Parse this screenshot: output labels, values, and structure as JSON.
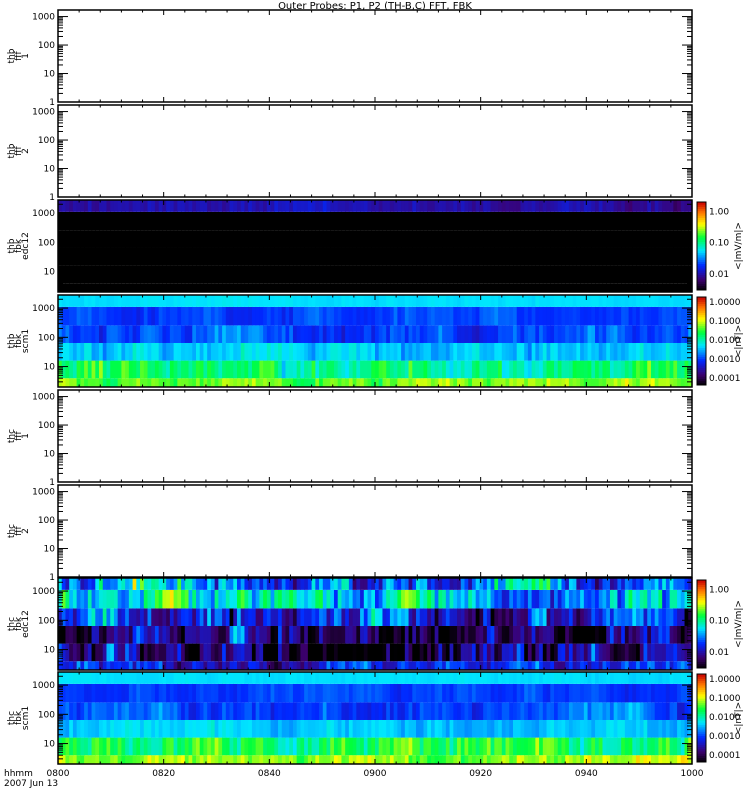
{
  "chart_data": {
    "type": "heatmap",
    "title": "Outer Probes: P1, P2 (TH-B,C) FFT, FBK",
    "x_ticks": [
      "0800",
      "0820",
      "0840",
      "0900",
      "0920",
      "0940",
      "1000"
    ],
    "x_range_minutes": [
      0,
      120
    ],
    "xlabel": "hhmm",
    "date_label": "2007 Jun 13",
    "panels": [
      {
        "label": [
          "thb",
          "fff",
          "1"
        ],
        "kind": "empty",
        "ylim": [
          1,
          1700
        ],
        "yticks": [
          "1",
          "10",
          "100",
          "1000"
        ]
      },
      {
        "label": [
          "thb",
          "fff",
          "2"
        ],
        "kind": "empty",
        "ylim": [
          1,
          1700
        ],
        "yticks": [
          "1",
          "10",
          "100",
          "1000"
        ]
      },
      {
        "label": [
          "thb",
          "fbk",
          "edc12"
        ],
        "kind": "spec",
        "ylim": [
          2,
          2800
        ],
        "yticks": [
          "10",
          "100",
          "1000"
        ],
        "band_edges": [
          2,
          4,
          16,
          64,
          256,
          1100,
          2800
        ],
        "band_log_mean": [
          -3.5,
          -3.5,
          -3.5,
          -3.5,
          -3.5,
          -2.0
        ],
        "band_log_sigma": [
          0.05,
          0.02,
          0.02,
          0.02,
          0.02,
          0.06
        ],
        "colorbar": {
          "label": "<|mV/m|>",
          "range": [
            0.003,
            2.05
          ],
          "ticks": [
            "1.00",
            "0.10",
            "0.01"
          ],
          "tick_values": [
            1,
            0.1,
            0.01
          ]
        }
      },
      {
        "label": [
          "thb",
          "fbk",
          "scm1"
        ],
        "kind": "spec",
        "ylim": [
          2,
          2800
        ],
        "yticks": [
          "10",
          "100",
          "1000"
        ],
        "band_edges": [
          2,
          4,
          16,
          64,
          256,
          1100,
          2800
        ],
        "band_log_mean": [
          -1.2,
          -1.8,
          -2.4,
          -2.95,
          -2.95,
          -2.3
        ],
        "band_log_sigma": [
          0.18,
          0.25,
          0.15,
          0.18,
          0.1,
          0.03
        ],
        "colorbar": {
          "label": "<|nT|>",
          "range": [
            4.4e-05,
            1.8
          ],
          "ticks": [
            "1.0000",
            "0.1000",
            "0.0100",
            "0.0010",
            "0.0001"
          ],
          "tick_values": [
            1,
            0.1,
            0.01,
            0.001,
            0.0001
          ]
        }
      },
      {
        "label": [
          "thc",
          "fff",
          "1"
        ],
        "kind": "empty",
        "ylim": [
          1,
          1700
        ],
        "yticks": [
          "1",
          "10",
          "100",
          "1000"
        ]
      },
      {
        "label": [
          "thc",
          "fff",
          "2"
        ],
        "kind": "empty",
        "ylim": [
          1,
          1700
        ],
        "yticks": [
          "1",
          "10",
          "100",
          "1000"
        ]
      },
      {
        "label": [
          "thc",
          "fbk",
          "edc12"
        ],
        "kind": "spec",
        "ylim": [
          2,
          2800
        ],
        "yticks": [
          "10",
          "100",
          "1000"
        ],
        "band_edges": [
          2,
          4,
          16,
          64,
          256,
          1100,
          2800
        ],
        "band_log_mean": [
          -1.75,
          -2.1,
          -2.15,
          -1.85,
          -1.1,
          -1.6
        ],
        "band_log_sigma": [
          0.2,
          0.3,
          0.3,
          0.3,
          0.3,
          0.35
        ],
        "colorbar": {
          "label": "<|mV/m|>",
          "range": [
            0.003,
            2.05
          ],
          "ticks": [
            "1.00",
            "0.10",
            "0.01"
          ],
          "tick_values": [
            1,
            0.1,
            0.01
          ]
        }
      },
      {
        "label": [
          "thc",
          "fbk",
          "scm1"
        ],
        "kind": "spec",
        "ylim": [
          2,
          2800
        ],
        "yticks": [
          "10",
          "100",
          "1000"
        ],
        "band_edges": [
          2,
          4,
          16,
          64,
          256,
          1100,
          2800
        ],
        "band_log_mean": [
          -1.2,
          -1.7,
          -2.4,
          -2.95,
          -2.95,
          -2.3
        ],
        "band_log_sigma": [
          0.18,
          0.25,
          0.12,
          0.15,
          0.08,
          0.03
        ],
        "colorbar": {
          "label": "<|nT|>",
          "range": [
            4.4e-05,
            1.8
          ],
          "ticks": [
            "1.0000",
            "0.1000",
            "0.0100",
            "0.0010",
            "0.0001"
          ],
          "tick_values": [
            1,
            0.1,
            0.01,
            0.001,
            0.0001
          ]
        }
      }
    ]
  }
}
